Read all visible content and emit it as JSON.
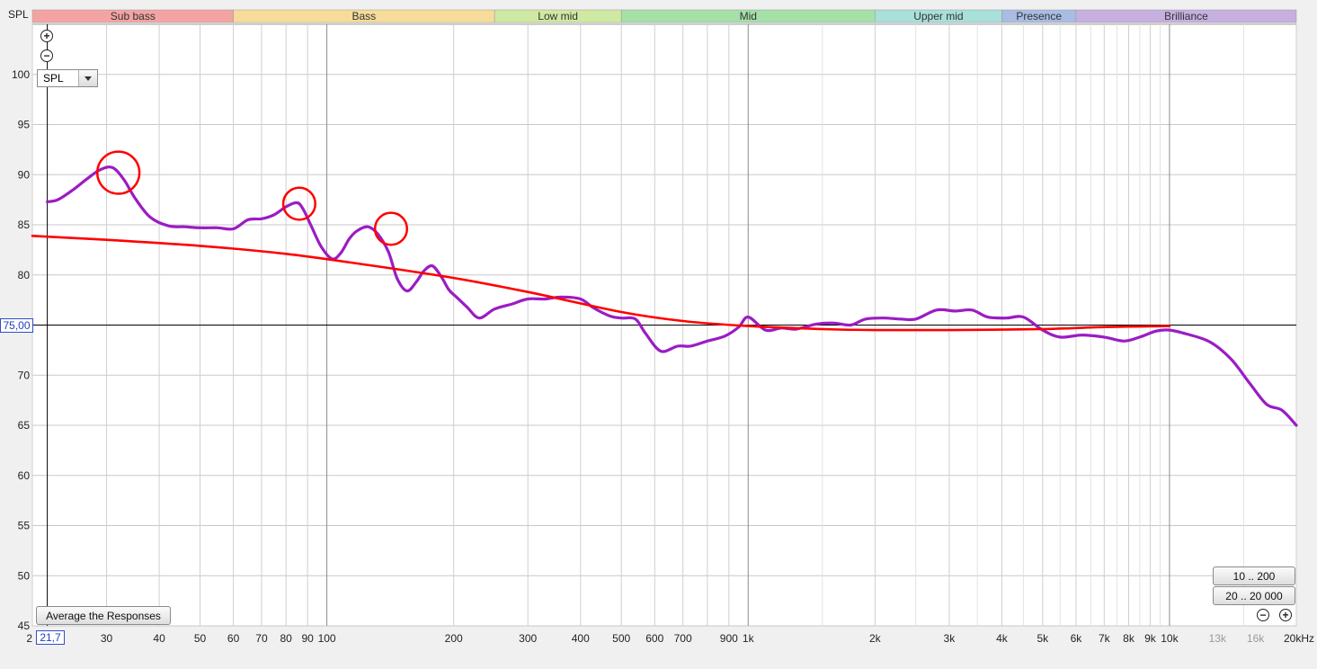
{
  "chart_data": {
    "type": "line",
    "ylabel": "SPL",
    "xscale": "log",
    "xlim": [
      20,
      20000
    ],
    "ylim": [
      45,
      105
    ],
    "grid": true,
    "y_ticks": [
      45,
      50,
      55,
      60,
      65,
      70,
      75,
      80,
      85,
      90,
      95,
      100
    ],
    "x_ticks": [
      {
        "v": 20,
        "label": "2"
      },
      {
        "v": 30,
        "label": "30"
      },
      {
        "v": 40,
        "label": "40"
      },
      {
        "v": 50,
        "label": "50"
      },
      {
        "v": 60,
        "label": "60"
      },
      {
        "v": 70,
        "label": "70"
      },
      {
        "v": 80,
        "label": "80"
      },
      {
        "v": 90,
        "label": "90"
      },
      {
        "v": 100,
        "label": "100"
      },
      {
        "v": 200,
        "label": "200"
      },
      {
        "v": 300,
        "label": "300"
      },
      {
        "v": 400,
        "label": "400"
      },
      {
        "v": 500,
        "label": "500"
      },
      {
        "v": 600,
        "label": "600"
      },
      {
        "v": 700,
        "label": "700"
      },
      {
        "v": 900,
        "label": "900"
      },
      {
        "v": 1000,
        "label": "1k"
      },
      {
        "v": 2000,
        "label": "2k"
      },
      {
        "v": 3000,
        "label": "3k"
      },
      {
        "v": 4000,
        "label": "4k"
      },
      {
        "v": 5000,
        "label": "5k"
      },
      {
        "v": 6000,
        "label": "6k"
      },
      {
        "v": 7000,
        "label": "7k"
      },
      {
        "v": 8000,
        "label": "8k"
      },
      {
        "v": 9000,
        "label": "9k"
      },
      {
        "v": 10000,
        "label": "10k"
      },
      {
        "v": 13000,
        "label": "13k",
        "muted": true
      },
      {
        "v": 16000,
        "label": "16k",
        "muted": true
      },
      {
        "v": 20000,
        "label": "20kHz"
      }
    ],
    "bands": [
      {
        "name": "Sub bass",
        "from": 20,
        "to": 60,
        "color": "#f4a3a3"
      },
      {
        "name": "Bass",
        "from": 60,
        "to": 250,
        "color": "#f6dc9a"
      },
      {
        "name": "Low mid",
        "from": 250,
        "to": 500,
        "color": "#cfe9a2"
      },
      {
        "name": "Mid",
        "from": 500,
        "to": 2000,
        "color": "#a4e0a8"
      },
      {
        "name": "Upper mid",
        "from": 2000,
        "to": 4000,
        "color": "#a8e0da"
      },
      {
        "name": "Presence",
        "from": 4000,
        "to": 6000,
        "color": "#a8bce4"
      },
      {
        "name": "Brilliance",
        "from": 6000,
        "to": 20000,
        "color": "#c6b0e0"
      }
    ],
    "reference_line": {
      "y": 75.0
    },
    "series": [
      {
        "color": "#9b1cc4",
        "x": [
          21.7,
          23,
          25,
          27,
          29,
          31,
          33,
          35,
          38,
          42,
          46,
          50,
          55,
          60,
          65,
          70,
          75,
          80,
          85,
          88,
          92,
          97,
          103,
          108,
          113,
          118,
          125,
          132,
          140,
          147,
          155,
          163,
          170,
          178,
          187,
          195,
          203,
          215,
          230,
          250,
          275,
          300,
          330,
          360,
          400,
          430,
          470,
          500,
          540,
          570,
          620,
          680,
          730,
          800,
          880,
          950,
          1000,
          1100,
          1200,
          1300,
          1450,
          1600,
          1750,
          1900,
          2100,
          2300,
          2500,
          2800,
          3100,
          3400,
          3700,
          4100,
          4500,
          5000,
          5500,
          6200,
          7000,
          7800,
          8500,
          9300,
          10000,
          11000,
          12500,
          14000,
          15500,
          17000,
          18500,
          20000
        ],
        "y": [
          87.3,
          87.5,
          88.5,
          89.6,
          90.5,
          90.7,
          89.5,
          87.7,
          85.8,
          84.9,
          84.8,
          84.7,
          84.7,
          84.6,
          85.5,
          85.6,
          86.0,
          86.8,
          87.2,
          86.5,
          84.8,
          82.8,
          81.6,
          82.2,
          83.6,
          84.4,
          84.8,
          84.1,
          82.3,
          79.6,
          78.4,
          79.3,
          80.4,
          80.9,
          79.8,
          78.5,
          77.8,
          76.8,
          75.7,
          76.6,
          77.1,
          77.6,
          77.6,
          77.8,
          77.6,
          76.7,
          75.9,
          75.7,
          75.6,
          74.2,
          72.4,
          72.9,
          72.9,
          73.4,
          73.9,
          74.8,
          75.8,
          74.5,
          74.7,
          74.6,
          75.1,
          75.2,
          75.0,
          75.6,
          75.7,
          75.6,
          75.6,
          76.5,
          76.4,
          76.5,
          75.8,
          75.7,
          75.8,
          74.5,
          73.8,
          74.0,
          73.8,
          73.4,
          73.8,
          74.4,
          74.5,
          74.1,
          73.3,
          71.6,
          69.2,
          67.1,
          66.5,
          65.0
        ]
      },
      {
        "color": "#ff0000",
        "x": [
          20,
          30,
          50,
          80,
          120,
          200,
          300,
          500,
          700,
          1000,
          1500,
          2000,
          3000,
          5000,
          7000,
          10000
        ],
        "y": [
          83.9,
          83.5,
          82.9,
          82.1,
          81.1,
          79.7,
          78.3,
          76.3,
          75.4,
          74.9,
          74.6,
          74.5,
          74.5,
          74.6,
          74.8,
          74.9
        ]
      }
    ],
    "annotations": [
      {
        "shape": "circle",
        "x": 32,
        "y": 90.2,
        "r_decades": 0.05,
        "color": "#ff0000"
      },
      {
        "shape": "circle",
        "x": 86,
        "y": 87.1,
        "r_decades": 0.038,
        "color": "#ff0000"
      },
      {
        "shape": "circle",
        "x": 142,
        "y": 84.6,
        "r_decades": 0.038,
        "color": "#ff0000"
      }
    ]
  },
  "ui": {
    "y_axis_title": "SPL",
    "select_value": "SPL",
    "average_button": "Average the Responses",
    "range_button_1": "10 .. 200",
    "range_button_2": "20 .. 20 000",
    "cursor_y_value": "75,00",
    "cursor_x_value": "21,7",
    "zoom_in_glyph": "+",
    "zoom_out_glyph": "−"
  }
}
